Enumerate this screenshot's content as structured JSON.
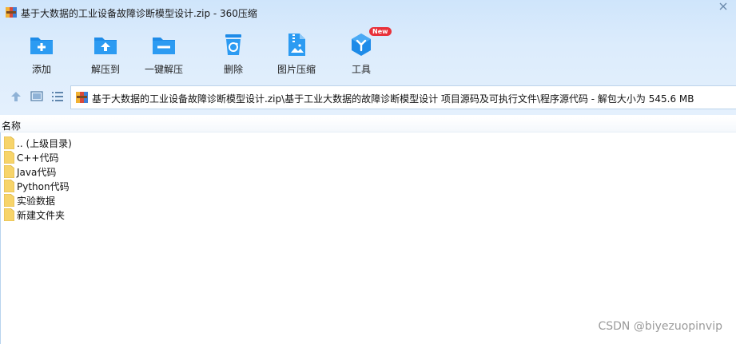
{
  "window": {
    "title": "基于大数据的工业设备故障诊断模型设计.zip - 360压缩"
  },
  "toolbar": {
    "items": [
      {
        "label": "添加",
        "icon": "add-folder-icon"
      },
      {
        "label": "解压到",
        "icon": "extract-to-icon"
      },
      {
        "label": "一键解压",
        "icon": "one-click-extract-icon"
      },
      {
        "label": "删除",
        "icon": "recycle-bin-icon"
      },
      {
        "label": "图片压缩",
        "icon": "image-compress-icon"
      },
      {
        "label": "工具",
        "icon": "tools-icon",
        "badge": "New"
      }
    ]
  },
  "navbar": {
    "path": "基于大数据的工业设备故障诊断模型设计.zip\\基于工业大数据的故障诊断模型设计 项目源码及可执行文件\\程序源代码 - 解包大小为 545.6 MB"
  },
  "list": {
    "column_name": "名称",
    "items": [
      {
        "label": ".. (上级目录)"
      },
      {
        "label": "C++代码"
      },
      {
        "label": "Java代码"
      },
      {
        "label": "Python代码"
      },
      {
        "label": "实验数据"
      },
      {
        "label": "新建文件夹"
      }
    ]
  },
  "watermark": "CSDN @biyezuopinvip",
  "colors": {
    "accent": "#1e8be8",
    "badge": "#e8313a",
    "folder": "#f7d46a"
  }
}
